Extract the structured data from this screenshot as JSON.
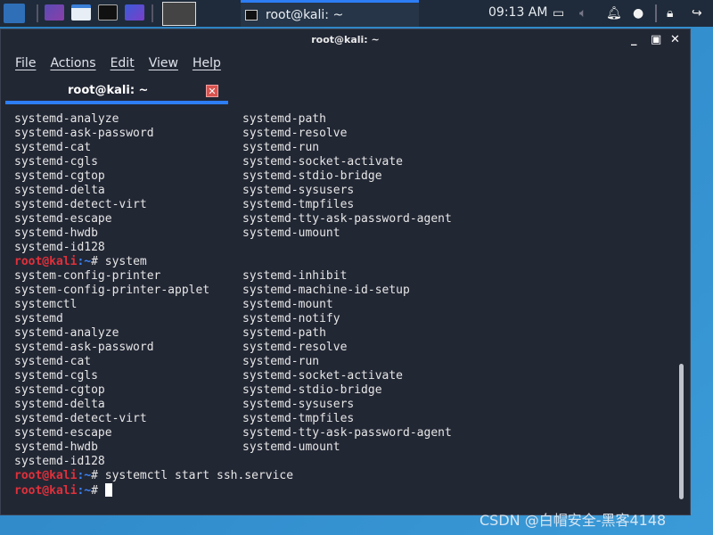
{
  "taskbar": {
    "active_task": "root@kali: ~",
    "clock": "09:13 AM",
    "icons": [
      "kali-menu-icon",
      "workspace-icon",
      "file-manager-icon",
      "terminal-icon",
      "screen-recorder-icon",
      "terminal-active-icon",
      "display-icon",
      "volume-icon",
      "bell-icon",
      "power-manager-icon",
      "lock-icon",
      "logout-icon"
    ]
  },
  "window": {
    "title": "root@kali: ~",
    "menu": [
      "File",
      "Actions",
      "Edit",
      "View",
      "Help"
    ],
    "tab": "root@kali: ~"
  },
  "prompt": {
    "user": "root@kali",
    "sep": ":~",
    "hash": "# "
  },
  "colors": {
    "prompt_user": "#e0303a",
    "prompt_path": "#3b82f6",
    "accent": "#2d7df5",
    "background": "#222734"
  },
  "lines": [
    {
      "c1": "systemd-analyze",
      "c2": "systemd-path"
    },
    {
      "c1": "systemd-ask-password",
      "c2": "systemd-resolve"
    },
    {
      "c1": "systemd-cat",
      "c2": "systemd-run"
    },
    {
      "c1": "systemd-cgls",
      "c2": "systemd-socket-activate"
    },
    {
      "c1": "systemd-cgtop",
      "c2": "systemd-stdio-bridge"
    },
    {
      "c1": "systemd-delta",
      "c2": "systemd-sysusers"
    },
    {
      "c1": "systemd-detect-virt",
      "c2": "systemd-tmpfiles"
    },
    {
      "c1": "systemd-escape",
      "c2": "systemd-tty-ask-password-agent"
    },
    {
      "c1": "systemd-hwdb",
      "c2": "systemd-umount"
    },
    {
      "c1": "systemd-id128",
      "c2": ""
    },
    {
      "cmd": "system"
    },
    {
      "c1": "system-config-printer",
      "c2": "systemd-inhibit"
    },
    {
      "c1": "system-config-printer-applet",
      "c2": "systemd-machine-id-setup"
    },
    {
      "c1": "systemctl",
      "c2": "systemd-mount"
    },
    {
      "c1": "systemd",
      "c2": "systemd-notify"
    },
    {
      "c1": "systemd-analyze",
      "c2": "systemd-path"
    },
    {
      "c1": "systemd-ask-password",
      "c2": "systemd-resolve"
    },
    {
      "c1": "systemd-cat",
      "c2": "systemd-run"
    },
    {
      "c1": "systemd-cgls",
      "c2": "systemd-socket-activate"
    },
    {
      "c1": "systemd-cgtop",
      "c2": "systemd-stdio-bridge"
    },
    {
      "c1": "systemd-delta",
      "c2": "systemd-sysusers"
    },
    {
      "c1": "systemd-detect-virt",
      "c2": "systemd-tmpfiles"
    },
    {
      "c1": "systemd-escape",
      "c2": "systemd-tty-ask-password-agent"
    },
    {
      "c1": "systemd-hwdb",
      "c2": "systemd-umount"
    },
    {
      "c1": "systemd-id128",
      "c2": ""
    },
    {
      "cmd": "systemctl start ssh.service"
    },
    {
      "cmd": "",
      "cursor": true
    }
  ],
  "watermark": "CSDN @白帽安全-黑客4148"
}
